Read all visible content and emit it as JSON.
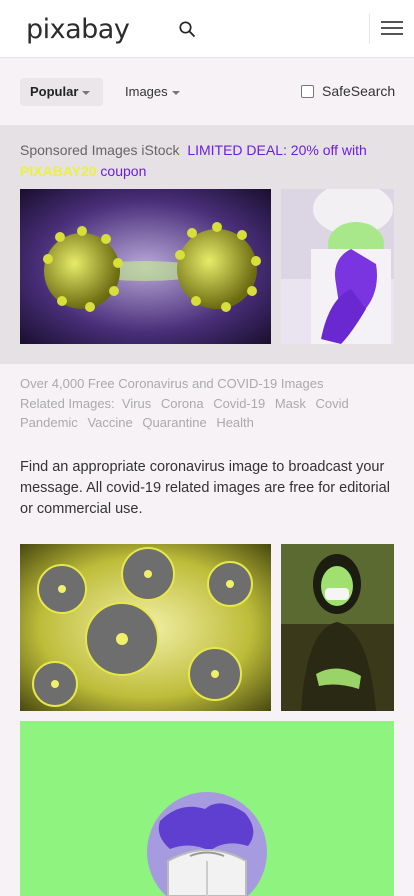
{
  "header": {
    "logo": "pixabay",
    "search_icon": "search-icon",
    "menu_icon": "hamburger-menu-icon"
  },
  "filters": {
    "popular_label": "Popular",
    "images_label": "Images",
    "safesearch_label": "SafeSearch",
    "safesearch_checked": false
  },
  "sponsored": {
    "prefix": "Sponsored Images iStock",
    "deal": "LIMITED DEAL: 20% off with",
    "code": "PIXABAY20",
    "suffix": "coupon"
  },
  "meta": {
    "count_line": "Over 4,000 Free Coronavirus and COVID-19 Images",
    "related_label": "Related Images:",
    "related_tags": [
      "Virus",
      "Corona",
      "Covid-19",
      "Mask",
      "Covid",
      "Pandemic",
      "Vaccine",
      "Quarantine",
      "Health"
    ]
  },
  "description": "Find an appropriate coronavirus image to broadcast your message. All covid-19 related images are free for editorial or commercial use.",
  "colors": {
    "accent": "#6b1ee0",
    "coupon": "#ecf041",
    "green_bg": "#8ff47f"
  }
}
